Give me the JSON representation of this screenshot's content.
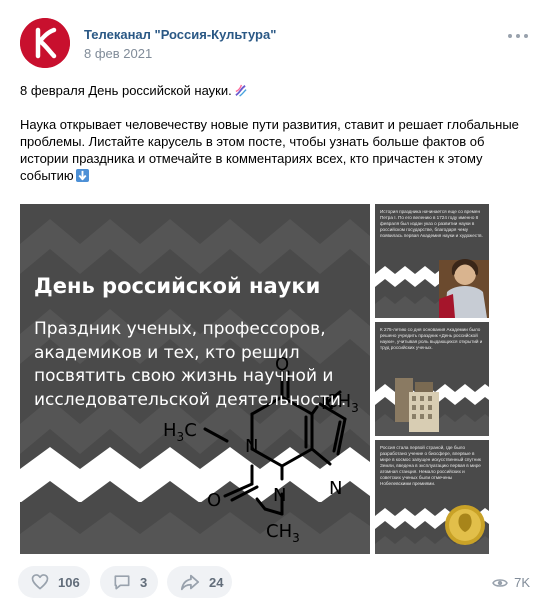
{
  "post": {
    "author": "Телеканал \"Россия-Культура\"",
    "date": "8 фев 2021",
    "paragraph1": "8 февраля День российской науки.",
    "paragraph2": "Наука открывает человечеству новые пути развития, ставит и решает глобальные проблемы. Листайте карусель в этом посте, чтобы узнать больше фактов об истории праздника и отмечайте в комментариях всех, кто причастен к этому событию"
  },
  "icons": {
    "avatar": "kultura-logo-icon",
    "dna": "dna-emoji-icon",
    "down_arrow": "down-arrow-emoji-icon",
    "more": "more-dots-icon",
    "like": "heart-icon",
    "comment": "comment-icon",
    "share": "share-icon",
    "views": "eye-icon"
  },
  "slide": {
    "title": "День российской науки",
    "subtitle": "Праздник ученых, профессоров, академиков и тех, кто решил посвятить свою жизнь научной и исследовательской деятельности.",
    "molecule": {
      "ch3_top": "CH",
      "ch3_top_sub": "3",
      "h3c": "H",
      "h3c_sub": "3",
      "h3c_c": "C",
      "n1": "N",
      "n2": "N",
      "n3": "N",
      "n4": "N",
      "o1": "O",
      "o2": "O",
      "ch3_bottom": "CH",
      "ch3_bottom_sub": "3"
    }
  },
  "thumbs": [
    {
      "text": "История праздника начинается еще со времен Петра I. По его велению в 1724 году именно 8 февраля был издан указ о развитии науки в российском государстве, благодаря чему появилась первая Академия науки и художеств."
    },
    {
      "text": "К 275-летию со дня основания Академии было решено учредить праздник «День российской науки», учитывая роль выдающихся открытий и труд российских ученых."
    },
    {
      "text": "Россия стала первой страной, где было разработано учение о биосфере, впервые в мире в космос запущен искусственный спутник Земли, введена в эксплуатацию первая в мире атомная станция. Немало российских и советских ученых были отмечены Нобелевскими премиями."
    }
  ],
  "footer": {
    "likes": "106",
    "comments": "3",
    "shares": "24",
    "views": "7K"
  },
  "colors": {
    "link": "#2a5885",
    "muted": "#818c99",
    "pill_bg": "#f0f2f5",
    "slide_bg": "#4a4a4a",
    "chevron": "#555555",
    "avatar": "#c8102e"
  }
}
